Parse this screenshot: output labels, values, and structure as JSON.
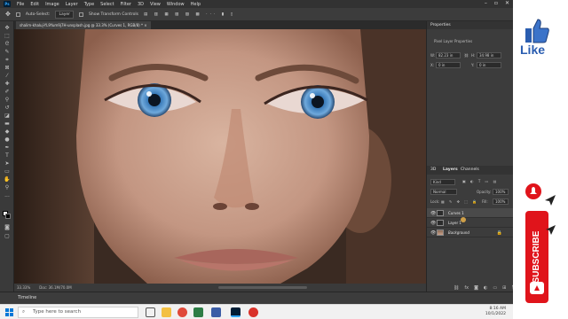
{
  "menubar": {
    "logo": "Ps",
    "items": [
      "File",
      "Edit",
      "Image",
      "Layer",
      "Type",
      "Select",
      "Filter",
      "3D",
      "View",
      "Window",
      "Help"
    ]
  },
  "options_bar": {
    "auto_select_label": "Auto-Select:",
    "auto_select_value": "Layer",
    "transform_label": "Show Transform Controls"
  },
  "document": {
    "tab_title": "shalim-khaluj-YL9Yum9j7H-unsplash.jpg @ 33.3% (Curves 1, RGB/8) *"
  },
  "status": {
    "zoom": "33.33%",
    "doc_size": "Doc: 36.1M/70.0M"
  },
  "timeline": {
    "label": "Timeline"
  },
  "properties": {
    "tab": "Properties",
    "subtitle": "Pixel Layer Properties",
    "w_label": "W:",
    "w_value": "82.23 in",
    "h_label": "H:",
    "h_value": "34.98 in",
    "x_label": "X:",
    "x_value": "0 in",
    "y_label": "Y:",
    "y_value": "0 in"
  },
  "layers_panel": {
    "tabs": [
      "3D",
      "Layers",
      "Channels"
    ],
    "filter": "Kind",
    "blend_mode": "Normal",
    "opacity_label": "Opacity:",
    "opacity_value": "100%",
    "lock_label": "Lock:",
    "fill_label": "Fill:",
    "fill_value": "100%",
    "layers": [
      {
        "name": "Curves 1",
        "active": true
      },
      {
        "name": "Layer 1",
        "active": false
      },
      {
        "name": "Background",
        "active": false,
        "locked": true
      }
    ]
  },
  "taskbar": {
    "search_placeholder": "Type here to search",
    "time": "8:16 AM",
    "date": "10/1/2022"
  },
  "promo": {
    "like_label": "Like",
    "subscribe_label": "SUBSCRIBE"
  },
  "colors": {
    "ps_blue": "#31a8ff",
    "subscribe_red": "#e0141b",
    "like_blue": "#2a5db0"
  }
}
